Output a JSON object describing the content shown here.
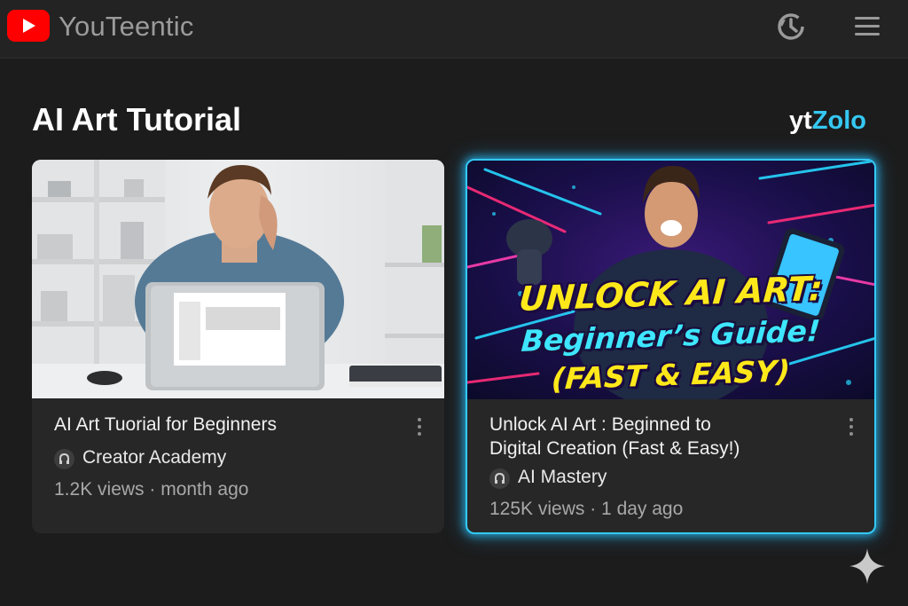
{
  "app": {
    "title": "YouTeentic"
  },
  "icons": {
    "logo": "youtube-play-logo",
    "history": "history-icon",
    "menu": "hamburger-menu-icon",
    "more": "more-vertical-icon",
    "channel": "channel-avatar-icon",
    "sparkle": "sparkle-icon"
  },
  "section": {
    "title": "AI Art Tutorial"
  },
  "brand": {
    "part1": "yt",
    "part2": "Zolo"
  },
  "colors": {
    "accent": "#33c9f6",
    "brand_red": "#ff0000",
    "background": "#1c1c1c",
    "card": "#272727"
  },
  "videos": [
    {
      "title": "AI Art Tuorial for Beginners",
      "channel": "Creator Academy",
      "meta": "1.2K views · month ago"
    },
    {
      "title_line1": "Unlock AI Art : Beginned to",
      "title_line2": "Digital Creation (Fast & Easy!)",
      "channel": "AI Mastery",
      "meta": "125K views · 1 day ago",
      "thumb_text": {
        "line1": "UNLOCK AI ART:",
        "line2": "Beginner’s Guide!",
        "line3": "(FAST & EASY)"
      }
    }
  ]
}
